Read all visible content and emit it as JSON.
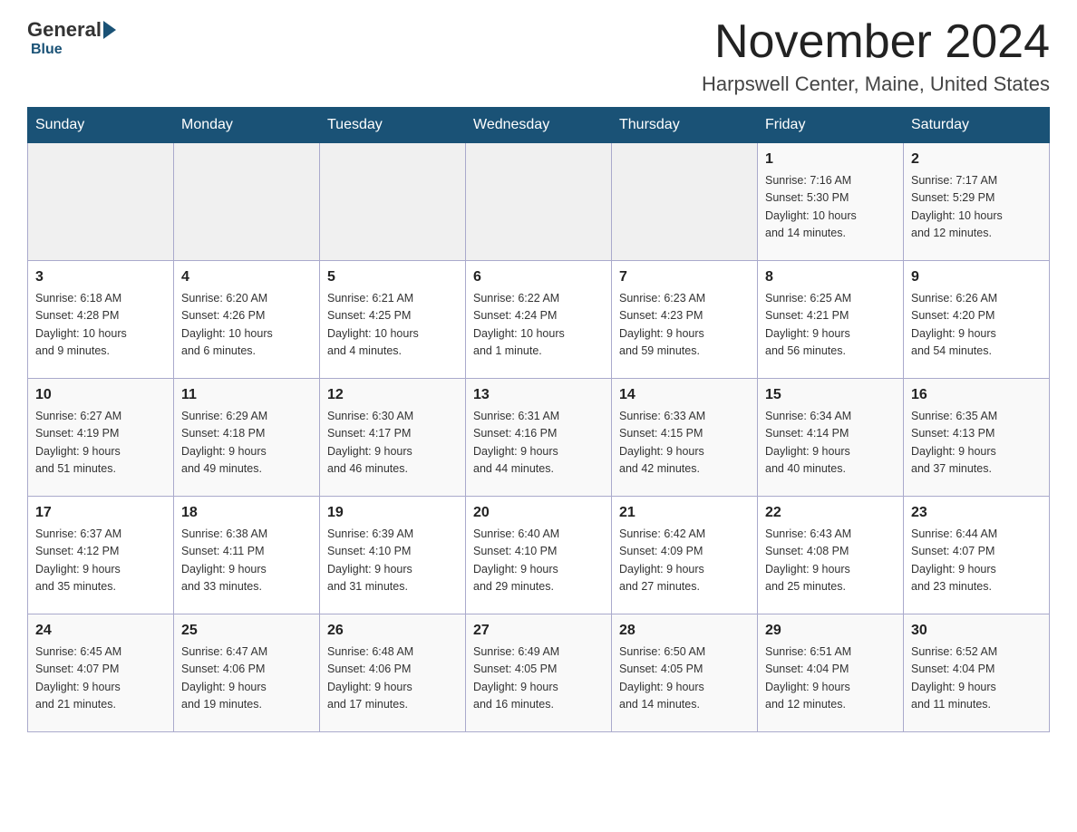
{
  "logo": {
    "part1": "General",
    "part2": "Blue"
  },
  "title": "November 2024",
  "subtitle": "Harpswell Center, Maine, United States",
  "weekdays": [
    "Sunday",
    "Monday",
    "Tuesday",
    "Wednesday",
    "Thursday",
    "Friday",
    "Saturday"
  ],
  "weeks": [
    [
      {
        "day": "",
        "info": ""
      },
      {
        "day": "",
        "info": ""
      },
      {
        "day": "",
        "info": ""
      },
      {
        "day": "",
        "info": ""
      },
      {
        "day": "",
        "info": ""
      },
      {
        "day": "1",
        "info": "Sunrise: 7:16 AM\nSunset: 5:30 PM\nDaylight: 10 hours\nand 14 minutes."
      },
      {
        "day": "2",
        "info": "Sunrise: 7:17 AM\nSunset: 5:29 PM\nDaylight: 10 hours\nand 12 minutes."
      }
    ],
    [
      {
        "day": "3",
        "info": "Sunrise: 6:18 AM\nSunset: 4:28 PM\nDaylight: 10 hours\nand 9 minutes."
      },
      {
        "day": "4",
        "info": "Sunrise: 6:20 AM\nSunset: 4:26 PM\nDaylight: 10 hours\nand 6 minutes."
      },
      {
        "day": "5",
        "info": "Sunrise: 6:21 AM\nSunset: 4:25 PM\nDaylight: 10 hours\nand 4 minutes."
      },
      {
        "day": "6",
        "info": "Sunrise: 6:22 AM\nSunset: 4:24 PM\nDaylight: 10 hours\nand 1 minute."
      },
      {
        "day": "7",
        "info": "Sunrise: 6:23 AM\nSunset: 4:23 PM\nDaylight: 9 hours\nand 59 minutes."
      },
      {
        "day": "8",
        "info": "Sunrise: 6:25 AM\nSunset: 4:21 PM\nDaylight: 9 hours\nand 56 minutes."
      },
      {
        "day": "9",
        "info": "Sunrise: 6:26 AM\nSunset: 4:20 PM\nDaylight: 9 hours\nand 54 minutes."
      }
    ],
    [
      {
        "day": "10",
        "info": "Sunrise: 6:27 AM\nSunset: 4:19 PM\nDaylight: 9 hours\nand 51 minutes."
      },
      {
        "day": "11",
        "info": "Sunrise: 6:29 AM\nSunset: 4:18 PM\nDaylight: 9 hours\nand 49 minutes."
      },
      {
        "day": "12",
        "info": "Sunrise: 6:30 AM\nSunset: 4:17 PM\nDaylight: 9 hours\nand 46 minutes."
      },
      {
        "day": "13",
        "info": "Sunrise: 6:31 AM\nSunset: 4:16 PM\nDaylight: 9 hours\nand 44 minutes."
      },
      {
        "day": "14",
        "info": "Sunrise: 6:33 AM\nSunset: 4:15 PM\nDaylight: 9 hours\nand 42 minutes."
      },
      {
        "day": "15",
        "info": "Sunrise: 6:34 AM\nSunset: 4:14 PM\nDaylight: 9 hours\nand 40 minutes."
      },
      {
        "day": "16",
        "info": "Sunrise: 6:35 AM\nSunset: 4:13 PM\nDaylight: 9 hours\nand 37 minutes."
      }
    ],
    [
      {
        "day": "17",
        "info": "Sunrise: 6:37 AM\nSunset: 4:12 PM\nDaylight: 9 hours\nand 35 minutes."
      },
      {
        "day": "18",
        "info": "Sunrise: 6:38 AM\nSunset: 4:11 PM\nDaylight: 9 hours\nand 33 minutes."
      },
      {
        "day": "19",
        "info": "Sunrise: 6:39 AM\nSunset: 4:10 PM\nDaylight: 9 hours\nand 31 minutes."
      },
      {
        "day": "20",
        "info": "Sunrise: 6:40 AM\nSunset: 4:10 PM\nDaylight: 9 hours\nand 29 minutes."
      },
      {
        "day": "21",
        "info": "Sunrise: 6:42 AM\nSunset: 4:09 PM\nDaylight: 9 hours\nand 27 minutes."
      },
      {
        "day": "22",
        "info": "Sunrise: 6:43 AM\nSunset: 4:08 PM\nDaylight: 9 hours\nand 25 minutes."
      },
      {
        "day": "23",
        "info": "Sunrise: 6:44 AM\nSunset: 4:07 PM\nDaylight: 9 hours\nand 23 minutes."
      }
    ],
    [
      {
        "day": "24",
        "info": "Sunrise: 6:45 AM\nSunset: 4:07 PM\nDaylight: 9 hours\nand 21 minutes."
      },
      {
        "day": "25",
        "info": "Sunrise: 6:47 AM\nSunset: 4:06 PM\nDaylight: 9 hours\nand 19 minutes."
      },
      {
        "day": "26",
        "info": "Sunrise: 6:48 AM\nSunset: 4:06 PM\nDaylight: 9 hours\nand 17 minutes."
      },
      {
        "day": "27",
        "info": "Sunrise: 6:49 AM\nSunset: 4:05 PM\nDaylight: 9 hours\nand 16 minutes."
      },
      {
        "day": "28",
        "info": "Sunrise: 6:50 AM\nSunset: 4:05 PM\nDaylight: 9 hours\nand 14 minutes."
      },
      {
        "day": "29",
        "info": "Sunrise: 6:51 AM\nSunset: 4:04 PM\nDaylight: 9 hours\nand 12 minutes."
      },
      {
        "day": "30",
        "info": "Sunrise: 6:52 AM\nSunset: 4:04 PM\nDaylight: 9 hours\nand 11 minutes."
      }
    ]
  ]
}
